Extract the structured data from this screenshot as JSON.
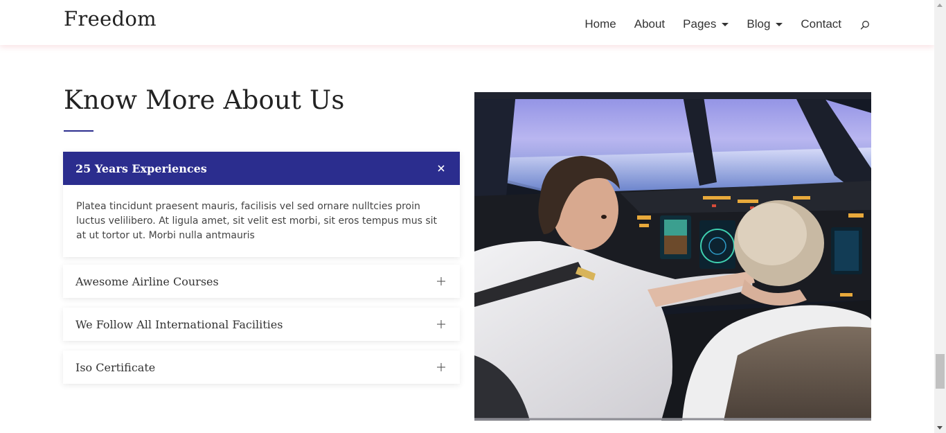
{
  "header": {
    "logo": "Freedom",
    "nav": [
      {
        "label": "Home",
        "has_dropdown": false
      },
      {
        "label": "About",
        "has_dropdown": false
      },
      {
        "label": "Pages",
        "has_dropdown": true
      },
      {
        "label": "Blog",
        "has_dropdown": true
      },
      {
        "label": "Contact",
        "has_dropdown": false
      }
    ],
    "search_icon": "search-icon"
  },
  "about": {
    "title": "Know More About Us",
    "accordion": [
      {
        "title": "25 Years Experiences",
        "expanded": true,
        "body": "Platea tincidunt praesent mauris, facilisis vel sed ornare nulltcies proin luctus velilibero. At ligula amet, sit velit est morbi, sit eros tempus mus sit at ut tortor ut. Morbi nulla antmauris",
        "icon": "close-icon"
      },
      {
        "title": "Awesome Airline Courses",
        "expanded": false,
        "icon": "plus-icon"
      },
      {
        "title": "We Follow All International Facilities",
        "expanded": false,
        "icon": "plus-icon"
      },
      {
        "title": "Iso Certificate",
        "expanded": false,
        "icon": "plus-icon"
      }
    ]
  },
  "colors": {
    "accent": "#2b2d8e",
    "header_shadow": "#f4d3d8"
  }
}
